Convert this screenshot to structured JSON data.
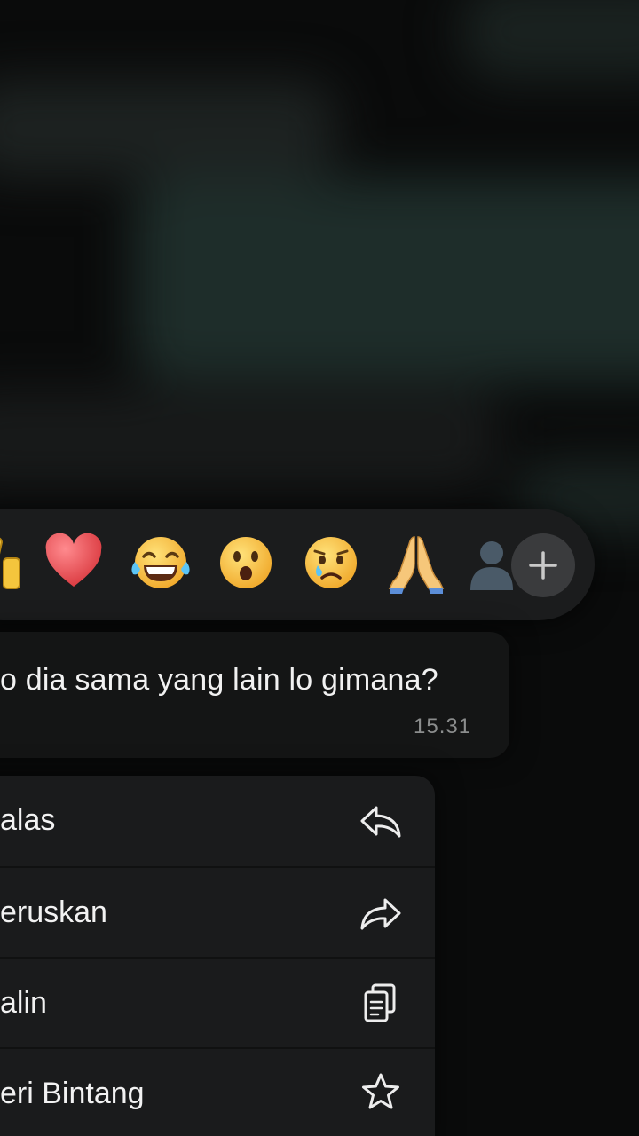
{
  "reactions": {
    "emojis": [
      {
        "name": "thumbs-up-icon",
        "glyph": "👍"
      },
      {
        "name": "red-heart-icon",
        "glyph": "❤️"
      },
      {
        "name": "face-with-tears-of-joy-icon",
        "glyph": "😂"
      },
      {
        "name": "face-with-open-mouth-icon",
        "glyph": "😮"
      },
      {
        "name": "crying-face-icon",
        "glyph": "😢"
      },
      {
        "name": "folded-hands-icon",
        "glyph": "🙏"
      },
      {
        "name": "partial-emoji-icon",
        "glyph": "👤"
      }
    ],
    "add_icon": "plus-icon"
  },
  "message": {
    "text": "o dia sama yang lain lo gimana?",
    "time": "15.31"
  },
  "menu": {
    "items": [
      {
        "label": "alas",
        "icon": "reply-icon"
      },
      {
        "label": "eruskan",
        "icon": "forward-icon"
      },
      {
        "label": "alin",
        "icon": "copy-icon"
      },
      {
        "label": "eri Bintang",
        "icon": "star-icon"
      }
    ]
  },
  "colors": {
    "background": "#0a0b0b",
    "reaction_bar": "#1b1c1d",
    "bubble": "#141515",
    "menu": "#1a1b1c",
    "add_button": "#3a3b3d",
    "text": "#f1f1f1",
    "timestamp": "#8b8d8d"
  }
}
